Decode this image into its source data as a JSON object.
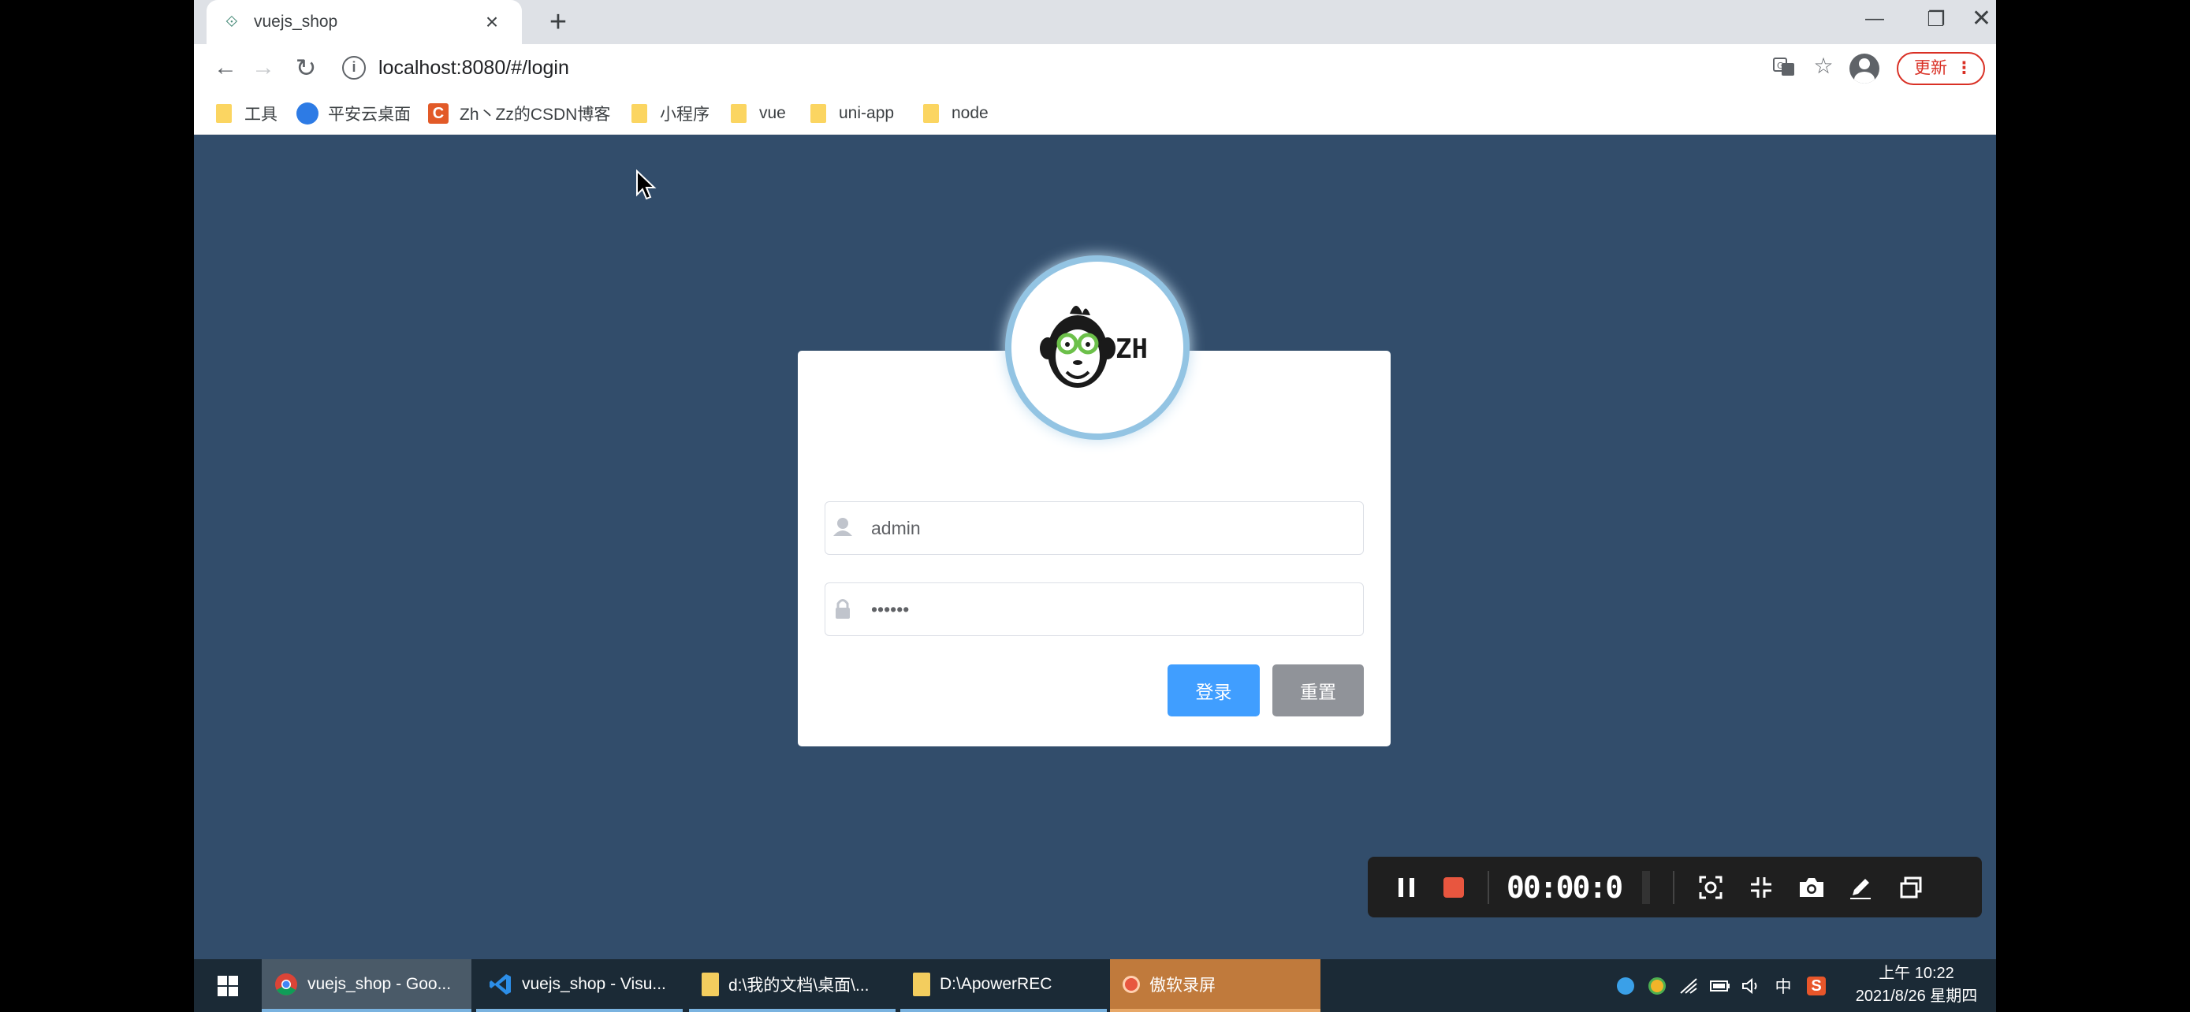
{
  "browser": {
    "tab": {
      "title": "vuejs_shop"
    },
    "address": {
      "url": "localhost:8080/#/login"
    },
    "update_label": "更新",
    "bookmarks": [
      {
        "label": "工具",
        "icon": "folder-icon"
      },
      {
        "label": "平安云桌面",
        "icon": "pingan-icon"
      },
      {
        "label": "Zh丶Zz的CSDN博客",
        "icon": "csdn-icon"
      },
      {
        "label": "小程序",
        "icon": "folder-icon"
      },
      {
        "label": "vue",
        "icon": "folder-icon"
      },
      {
        "label": "uni-app",
        "icon": "folder-icon"
      },
      {
        "label": "node",
        "icon": "folder-icon"
      }
    ]
  },
  "login": {
    "avatar_text": "ZH",
    "username": {
      "value": "admin"
    },
    "password": {
      "value": "••••••"
    },
    "buttons": {
      "login": "登录",
      "reset": "重置"
    }
  },
  "recorder": {
    "timer": "00:00:0"
  },
  "taskbar": {
    "tasks": [
      {
        "label": "vuejs_shop - Goo..."
      },
      {
        "label": "vuejs_shop - Visu..."
      },
      {
        "label": "d:\\我的文档\\桌面\\..."
      },
      {
        "label": "D:\\ApowerREC"
      },
      {
        "label": "傲软录屏"
      }
    ],
    "tray": {
      "ime": "中"
    },
    "clock": {
      "time": "上午 10:22",
      "date": "2021/8/26 星期四"
    }
  },
  "colors": {
    "page_bg": "#324d6b",
    "primary_button": "#409eff",
    "info_button": "#909399",
    "avatar_border": "#93c4e3"
  }
}
